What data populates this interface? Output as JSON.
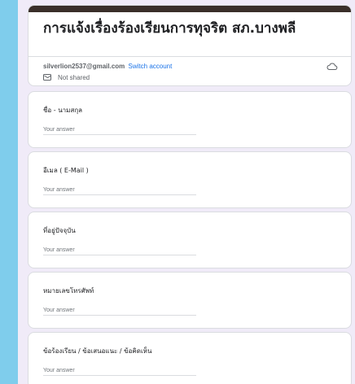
{
  "form": {
    "title": "การแจ้งเรื่องร้องเรียนการทุจริต สภ.บางพลี",
    "account_email": "silverlion2537@gmail.com",
    "switch_account": "Switch account",
    "not_shared": "Not shared",
    "theme_color": "#3a2f2a",
    "background_color": "#f0ebf8"
  },
  "questions": [
    {
      "label": "ชื่อ - นามสกุล",
      "placeholder": "Your answer"
    },
    {
      "label": "อีเมล ( E-Mail )",
      "placeholder": "Your answer"
    },
    {
      "label": "ที่อยู่ปัจจุบัน",
      "placeholder": "Your answer"
    },
    {
      "label": "หมายเลขโทรศัพท์",
      "placeholder": "Your answer"
    },
    {
      "label": "ข้อร้องเรียน / ข้อเสนอแนะ / ข้อคิดเห็น",
      "placeholder": "Your answer"
    }
  ],
  "icons": {
    "cloud": "cloud-saved-icon",
    "not_shared": "not-shared-icon"
  }
}
